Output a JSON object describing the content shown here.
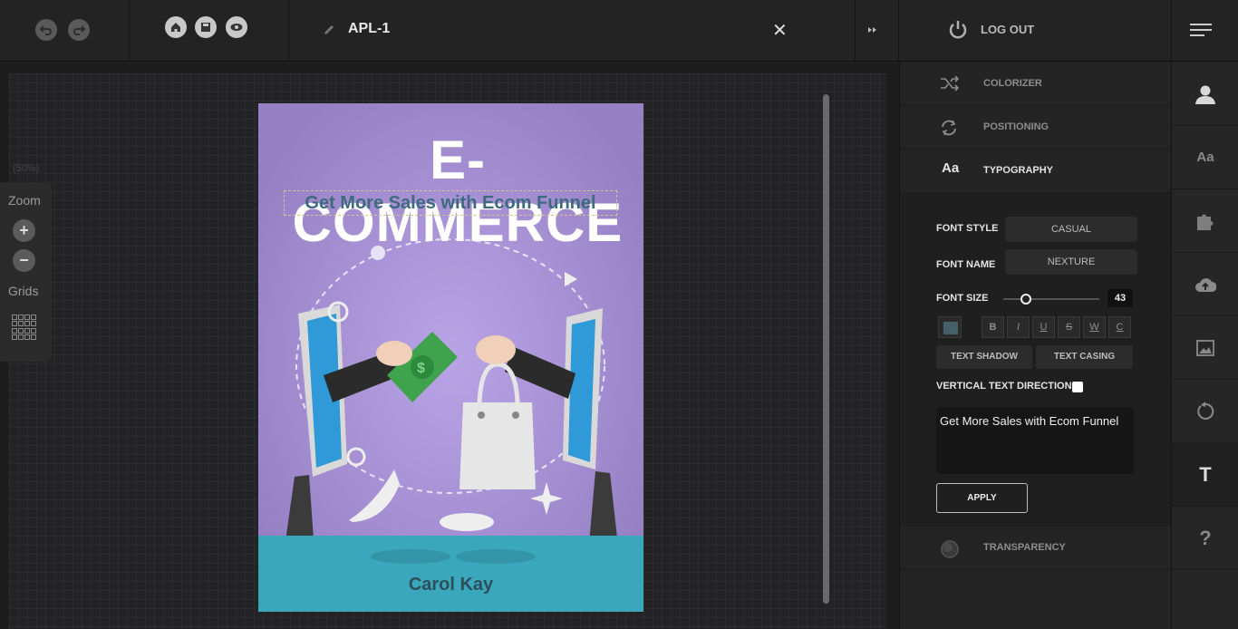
{
  "topbar": {
    "doc_title": "APL-1",
    "logout_label": "LOG OUT"
  },
  "zoom": {
    "percent": "(50%)",
    "label": "Zoom",
    "plus": "+",
    "minus": "−",
    "grids_label": "Grids"
  },
  "book": {
    "title": "E-COMMERCE",
    "subtitle": "Get More Sales with Ecom Funnel",
    "author": "Carol Kay"
  },
  "panel": {
    "menu": [
      {
        "label": "COLORIZER"
      },
      {
        "label": "POSITIONING"
      },
      {
        "label": "TYPOGRAPHY",
        "icon_text": "Aa"
      }
    ],
    "font_style_label": "FONT STYLE",
    "font_style_value": "CASUAL",
    "font_name_label": "FONT NAME",
    "font_name_value": "NEXTURE",
    "font_size_label": "FONT SIZE",
    "font_size_value": "43",
    "font_size_fraction": 0.2,
    "text_color": "#45606b",
    "format_buttons": [
      "B",
      "I",
      "U",
      "S",
      "W",
      "C"
    ],
    "text_shadow_label": "TEXT SHADOW",
    "text_casing_label": "TEXT CASING",
    "vertical_label": "VERTICAL TEXT DIRECTION",
    "text_value": "Get More Sales with Ecom Funnel",
    "apply_label": "APPLY",
    "transparency_label": "TRANSPARENCY"
  },
  "sidebar": {
    "font_icon_text": "Aa",
    "text_icon_text": "T",
    "help_icon_text": "?"
  }
}
